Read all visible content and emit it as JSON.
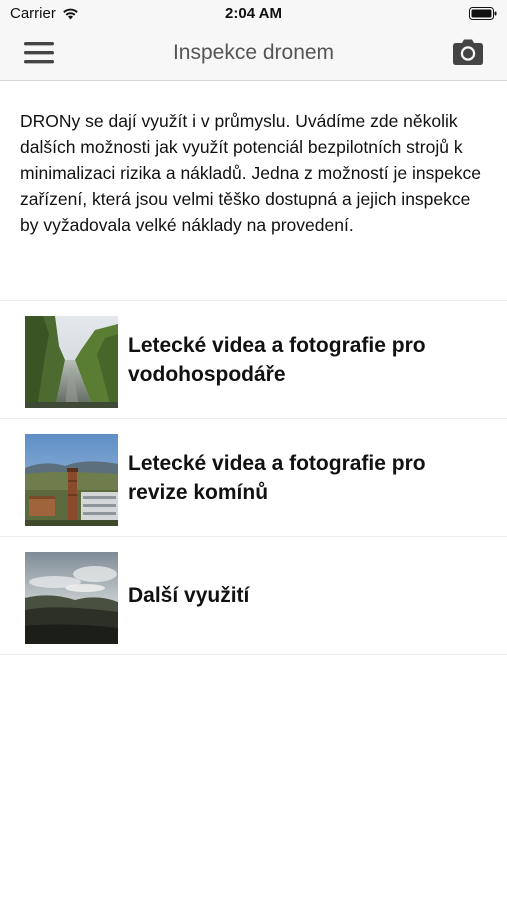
{
  "status_bar": {
    "carrier": "Carrier",
    "time": "2:04 AM",
    "icons": [
      "wifi-icon",
      "battery-icon"
    ]
  },
  "nav_bar": {
    "title": "Inspekce dronem",
    "left_icon": "hamburger-menu-icon",
    "right_icon": "camera-icon"
  },
  "intro": {
    "text": "DRONy se dají využít i v průmyslu. Uvádíme zde několik dalších možnosti jak využít potenciál bezpilotních strojů k minimalizaci rizika a nákladů. Jedna z možností je inspekce zařízení, která jsou velmi těško dostupná a jejich inspekce by vyžadovala velké náklady na provedení."
  },
  "list": {
    "items": [
      {
        "title": "Letecké videa a fotografie pro vodohospodáře",
        "thumbnail": "river-photo"
      },
      {
        "title": "Letecké videa a fotografie pro revize komínů",
        "thumbnail": "chimney-photo"
      },
      {
        "title": "Další využití",
        "thumbnail": "landscape-photo"
      }
    ]
  },
  "colors": {
    "bar_background": "#f7f7f7",
    "title_text": "#555555",
    "body_text": "#111111",
    "separator": "#ededed"
  }
}
